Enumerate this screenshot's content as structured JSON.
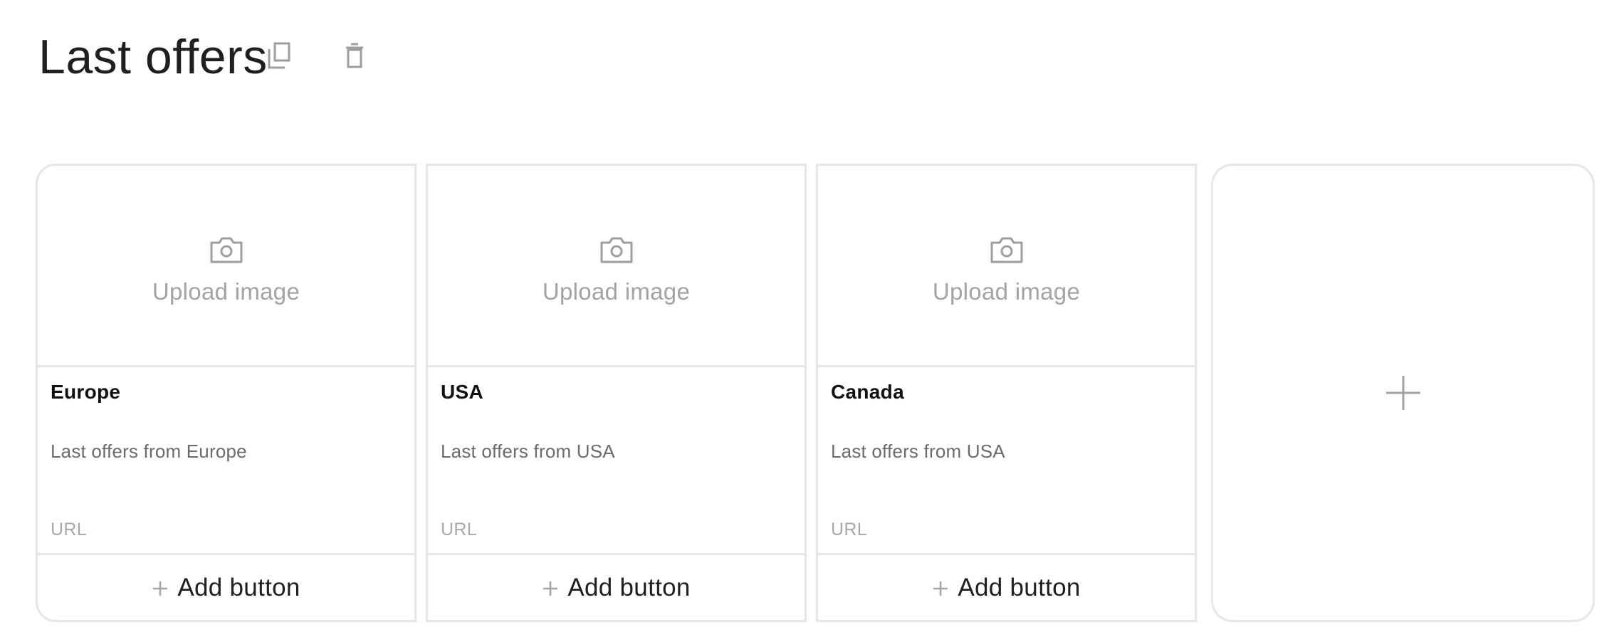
{
  "header": {
    "title": "Last offers",
    "icons": [
      "copy-icon",
      "trash-icon"
    ]
  },
  "cards": [
    {
      "upload_label": "Upload image",
      "title": "Europe",
      "description": "Last offers from Europe",
      "url_placeholder": "URL",
      "add_button_label": "Add button"
    },
    {
      "upload_label": "Upload image",
      "title": "USA",
      "description": "Last offers from USA",
      "url_placeholder": "URL",
      "add_button_label": "Add button"
    },
    {
      "upload_label": "Upload image",
      "title": "Canada",
      "description": "Last offers from USA",
      "url_placeholder": "URL",
      "add_button_label": "Add button"
    }
  ],
  "add_card": {
    "icon": "plus-icon"
  },
  "colors": {
    "border": "#e6e6e6",
    "muted_text": "#a3a3a3",
    "icon_gray": "#9e9e9e",
    "text": "#1f1f1f"
  }
}
